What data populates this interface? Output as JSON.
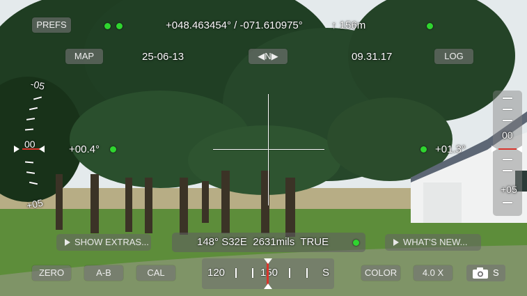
{
  "top": {
    "prefs_label": "PREFS",
    "coordinates": "+048.463454° / -071.610975°",
    "altitude": "↑ 156m",
    "map_label": "MAP",
    "date": "25-06-13",
    "north_label": "◀N▶",
    "time": "09.31.17",
    "log_label": "LOG"
  },
  "left_scale": {
    "top_label": "-05",
    "center_label": "00",
    "bottom_label": "+05",
    "tilt_value": "+00.4°"
  },
  "right_scale": {
    "center_label": "00",
    "bottom_label": "+05",
    "tilt_value": "+01.3°"
  },
  "middle": {
    "show_extras_label": "SHOW EXTRAS...",
    "bearing_readout": "148° S32E  2631mils  TRUE",
    "whats_new_label": "WHAT'S NEW..."
  },
  "bottom": {
    "zero_label": "ZERO",
    "ab_label": "A-B",
    "cal_label": "CAL",
    "compass_left": "120",
    "compass_center": "150",
    "compass_right": "S",
    "color_label": "COLOR",
    "zoom_label": "4.0 X",
    "camera_suffix": "S"
  },
  "colors": {
    "status_dot": "#2fd52f",
    "marker": "#d9342b"
  }
}
